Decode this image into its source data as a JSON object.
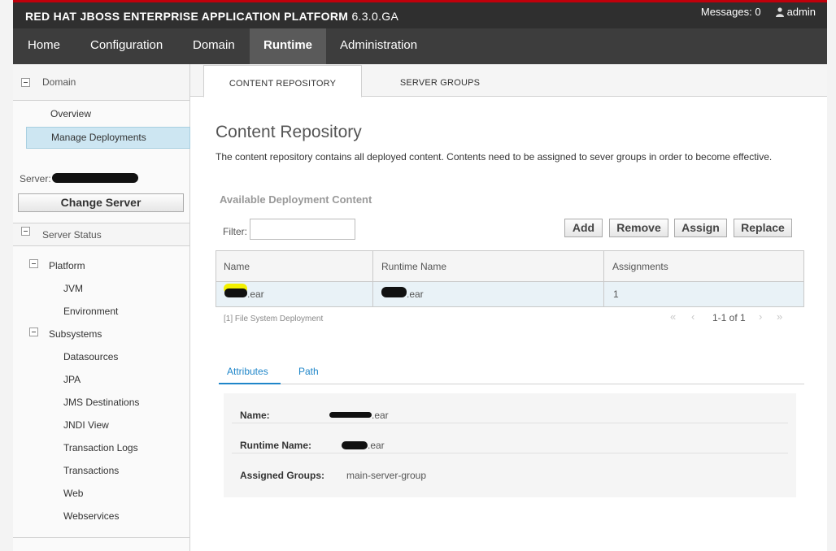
{
  "header": {
    "brand": "RED HAT JBOSS ENTERPRISE APPLICATION PLATFORM",
    "version": "6.3.0.GA",
    "messages": "Messages: 0",
    "user": "admin"
  },
  "nav": {
    "items": [
      "Home",
      "Configuration",
      "Domain",
      "Runtime",
      "Administration"
    ],
    "active": "Runtime"
  },
  "sidebar": {
    "domain_section": "Domain",
    "overview": "Overview",
    "manage_deployments": "Manage Deployments",
    "server_label": "Server:",
    "change_server": "Change Server",
    "server_status_section": "Server Status",
    "platform": "Platform",
    "jvm": "JVM",
    "environment": "Environment",
    "subsystems": "Subsystems",
    "subsystem_items": [
      "Datasources",
      "JPA",
      "JMS Destinations",
      "JNDI View",
      "Transaction Logs",
      "Transactions",
      "Web",
      "Webservices"
    ]
  },
  "tabs": {
    "content_repository": "CONTENT REPOSITORY",
    "server_groups": "SERVER GROUPS"
  },
  "main": {
    "title": "Content Repository",
    "description": "The content repository contains all deployed content. Contents need to be assigned to sever groups in order to become effective.",
    "subtitle": "Available Deployment Content",
    "filter_label": "Filter:",
    "filter_value": "",
    "buttons": {
      "add": "Add",
      "remove": "Remove",
      "assign": "Assign",
      "replace": "Replace"
    }
  },
  "table": {
    "headers": [
      "Name",
      "Runtime Name",
      "Assignments"
    ],
    "row": {
      "name": ".ear",
      "runtime_name": ".ear",
      "assignments": "1"
    },
    "footnote": "[1] File System Deployment",
    "pager": "1-1 of 1"
  },
  "detail": {
    "tabs": [
      "Attributes",
      "Path"
    ],
    "name_key": "Name:",
    "name_value": ".ear",
    "runtime_key": "Runtime Name:",
    "runtime_value": ".ear",
    "groups_key": "Assigned Groups:",
    "groups_value": "main-server-group"
  },
  "colors": {
    "accent_red": "#c0000b",
    "link_blue": "#1f86c9",
    "selected_bg": "#cde6f2",
    "header_dark": "#2f2f2f"
  }
}
